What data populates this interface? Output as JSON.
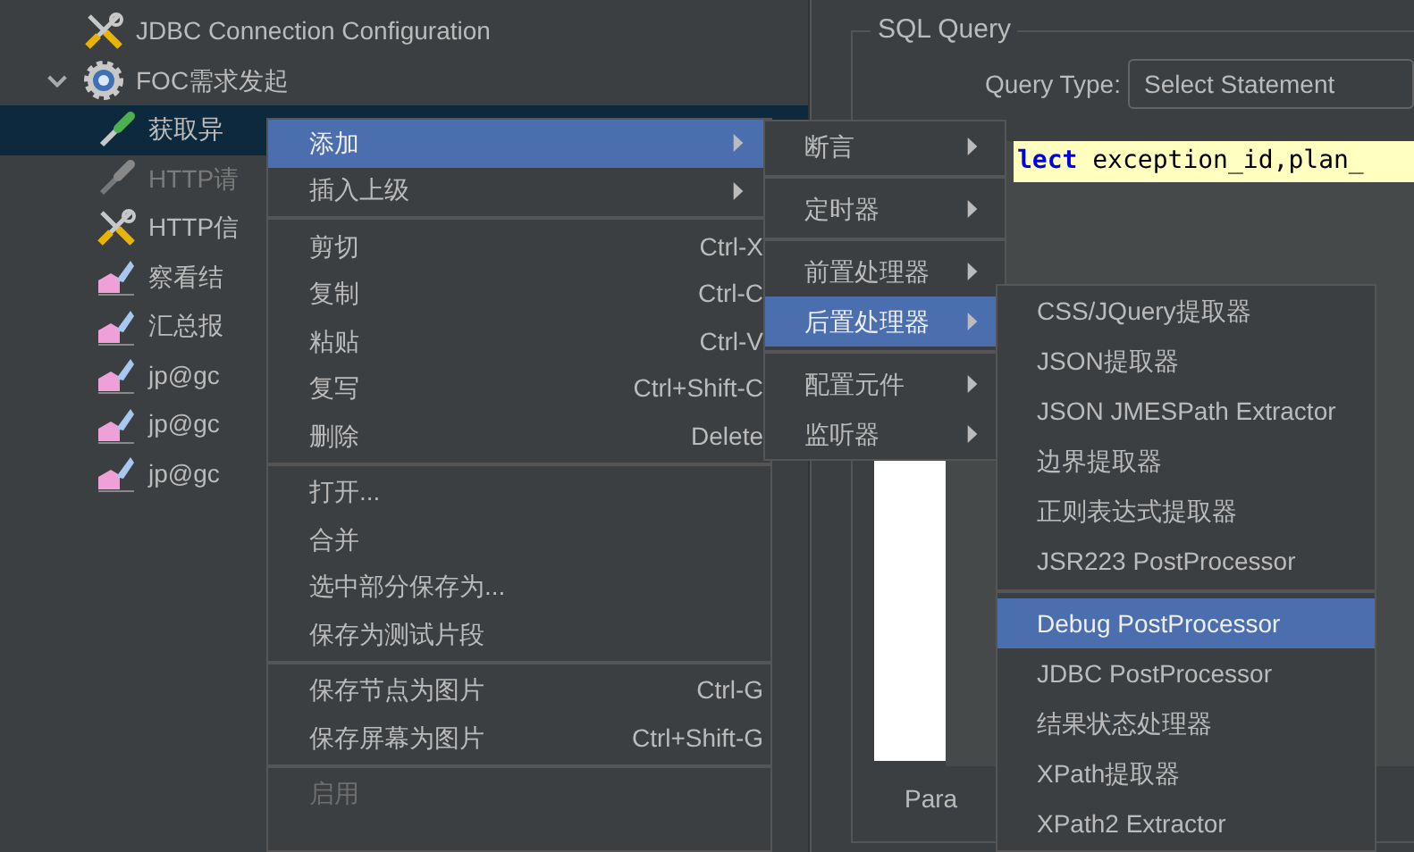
{
  "tree": {
    "items": [
      {
        "label": "JDBC Connection Configuration",
        "kind": "tools",
        "disabled": false,
        "selected": false
      },
      {
        "label": "FOC需求发起",
        "kind": "gear",
        "expanded": true,
        "disabled": false,
        "selected": false,
        "children": [
          {
            "label": "获取异",
            "kind": "dropper",
            "disabled": false,
            "selected": true
          },
          {
            "label": "HTTP请",
            "kind": "dropper",
            "disabled": true,
            "selected": false
          },
          {
            "label": "HTTP信",
            "kind": "tools",
            "disabled": false,
            "selected": false
          },
          {
            "label": "察看结",
            "kind": "chart",
            "disabled": false,
            "selected": false
          },
          {
            "label": "汇总报",
            "kind": "chart",
            "disabled": false,
            "selected": false
          },
          {
            "label": "jp@gc",
            "kind": "chart",
            "disabled": false,
            "selected": false
          },
          {
            "label": "jp@gc",
            "kind": "chart",
            "disabled": false,
            "selected": false
          },
          {
            "label": "jp@gc",
            "kind": "chart",
            "disabled": false,
            "selected": false
          }
        ]
      }
    ]
  },
  "sql_panel": {
    "title": "SQL Query",
    "query_type_label": "Query Type:",
    "query_type_value": "Select Statement",
    "code": [
      {
        "kind": "keyword",
        "text": "lect"
      },
      {
        "kind": "plain",
        "text": " exception_id,plan_"
      }
    ],
    "footer_label": "Para"
  },
  "context_menu": {
    "items": [
      {
        "kind": "item",
        "label": "添加",
        "submenu": true,
        "selected": true,
        "disabled": false
      },
      {
        "kind": "item",
        "label": "插入上级",
        "submenu": true,
        "selected": false,
        "disabled": false
      },
      {
        "kind": "separator"
      },
      {
        "kind": "item",
        "label": "剪切",
        "shortcut": "Ctrl-X",
        "submenu": false,
        "selected": false,
        "disabled": false
      },
      {
        "kind": "item",
        "label": "复制",
        "shortcut": "Ctrl-C",
        "submenu": false,
        "selected": false,
        "disabled": false
      },
      {
        "kind": "item",
        "label": "粘贴",
        "shortcut": "Ctrl-V",
        "submenu": false,
        "selected": false,
        "disabled": false
      },
      {
        "kind": "item",
        "label": "复写",
        "shortcut": "Ctrl+Shift-C",
        "submenu": false,
        "selected": false,
        "disabled": false
      },
      {
        "kind": "item",
        "label": "删除",
        "shortcut": "Delete",
        "submenu": false,
        "selected": false,
        "disabled": false
      },
      {
        "kind": "separator"
      },
      {
        "kind": "item",
        "label": "打开...",
        "submenu": false,
        "selected": false,
        "disabled": false
      },
      {
        "kind": "item",
        "label": "合并",
        "submenu": false,
        "selected": false,
        "disabled": false
      },
      {
        "kind": "item",
        "label": "选中部分保存为...",
        "submenu": false,
        "selected": false,
        "disabled": false
      },
      {
        "kind": "item",
        "label": "保存为测试片段",
        "submenu": false,
        "selected": false,
        "disabled": false
      },
      {
        "kind": "separator"
      },
      {
        "kind": "item",
        "label": "保存节点为图片",
        "shortcut": "Ctrl-G",
        "submenu": false,
        "selected": false,
        "disabled": false
      },
      {
        "kind": "item",
        "label": "保存屏幕为图片",
        "shortcut": "Ctrl+Shift-G",
        "submenu": false,
        "selected": false,
        "disabled": false
      },
      {
        "kind": "separator"
      },
      {
        "kind": "item",
        "label": "启用",
        "submenu": false,
        "selected": false,
        "disabled": true
      }
    ]
  },
  "add_submenu": {
    "items": [
      {
        "kind": "item",
        "label": "断言",
        "submenu": true,
        "selected": false,
        "disabled": false
      },
      {
        "kind": "separator"
      },
      {
        "kind": "item",
        "label": "定时器",
        "submenu": true,
        "selected": false,
        "disabled": false
      },
      {
        "kind": "separator"
      },
      {
        "kind": "item",
        "label": "前置处理器",
        "submenu": true,
        "selected": false,
        "disabled": false
      },
      {
        "kind": "item",
        "label": "后置处理器",
        "submenu": true,
        "selected": true,
        "disabled": false
      },
      {
        "kind": "separator"
      },
      {
        "kind": "item",
        "label": "配置元件",
        "submenu": true,
        "selected": false,
        "disabled": false
      },
      {
        "kind": "item",
        "label": "监听器",
        "submenu": true,
        "selected": false,
        "disabled": false
      }
    ]
  },
  "postprocessor_submenu": {
    "items": [
      {
        "kind": "item",
        "label": "CSS/JQuery提取器",
        "submenu": false,
        "selected": false,
        "disabled": false
      },
      {
        "kind": "item",
        "label": "JSON提取器",
        "submenu": false,
        "selected": false,
        "disabled": false
      },
      {
        "kind": "item",
        "label": "JSON JMESPath Extractor",
        "submenu": false,
        "selected": false,
        "disabled": false
      },
      {
        "kind": "item",
        "label": "边界提取器",
        "submenu": false,
        "selected": false,
        "disabled": false
      },
      {
        "kind": "item",
        "label": "正则表达式提取器",
        "submenu": false,
        "selected": false,
        "disabled": false
      },
      {
        "kind": "item",
        "label": "JSR223 PostProcessor",
        "submenu": false,
        "selected": false,
        "disabled": false
      },
      {
        "kind": "separator"
      },
      {
        "kind": "item",
        "label": "Debug PostProcessor",
        "submenu": false,
        "selected": true,
        "disabled": false
      },
      {
        "kind": "item",
        "label": "JDBC PostProcessor",
        "submenu": false,
        "selected": false,
        "disabled": false
      },
      {
        "kind": "item",
        "label": "结果状态处理器",
        "submenu": false,
        "selected": false,
        "disabled": false
      },
      {
        "kind": "item",
        "label": "XPath提取器",
        "submenu": false,
        "selected": false,
        "disabled": false
      },
      {
        "kind": "item",
        "label": "XPath2 Extractor",
        "submenu": false,
        "selected": false,
        "disabled": false
      }
    ]
  }
}
